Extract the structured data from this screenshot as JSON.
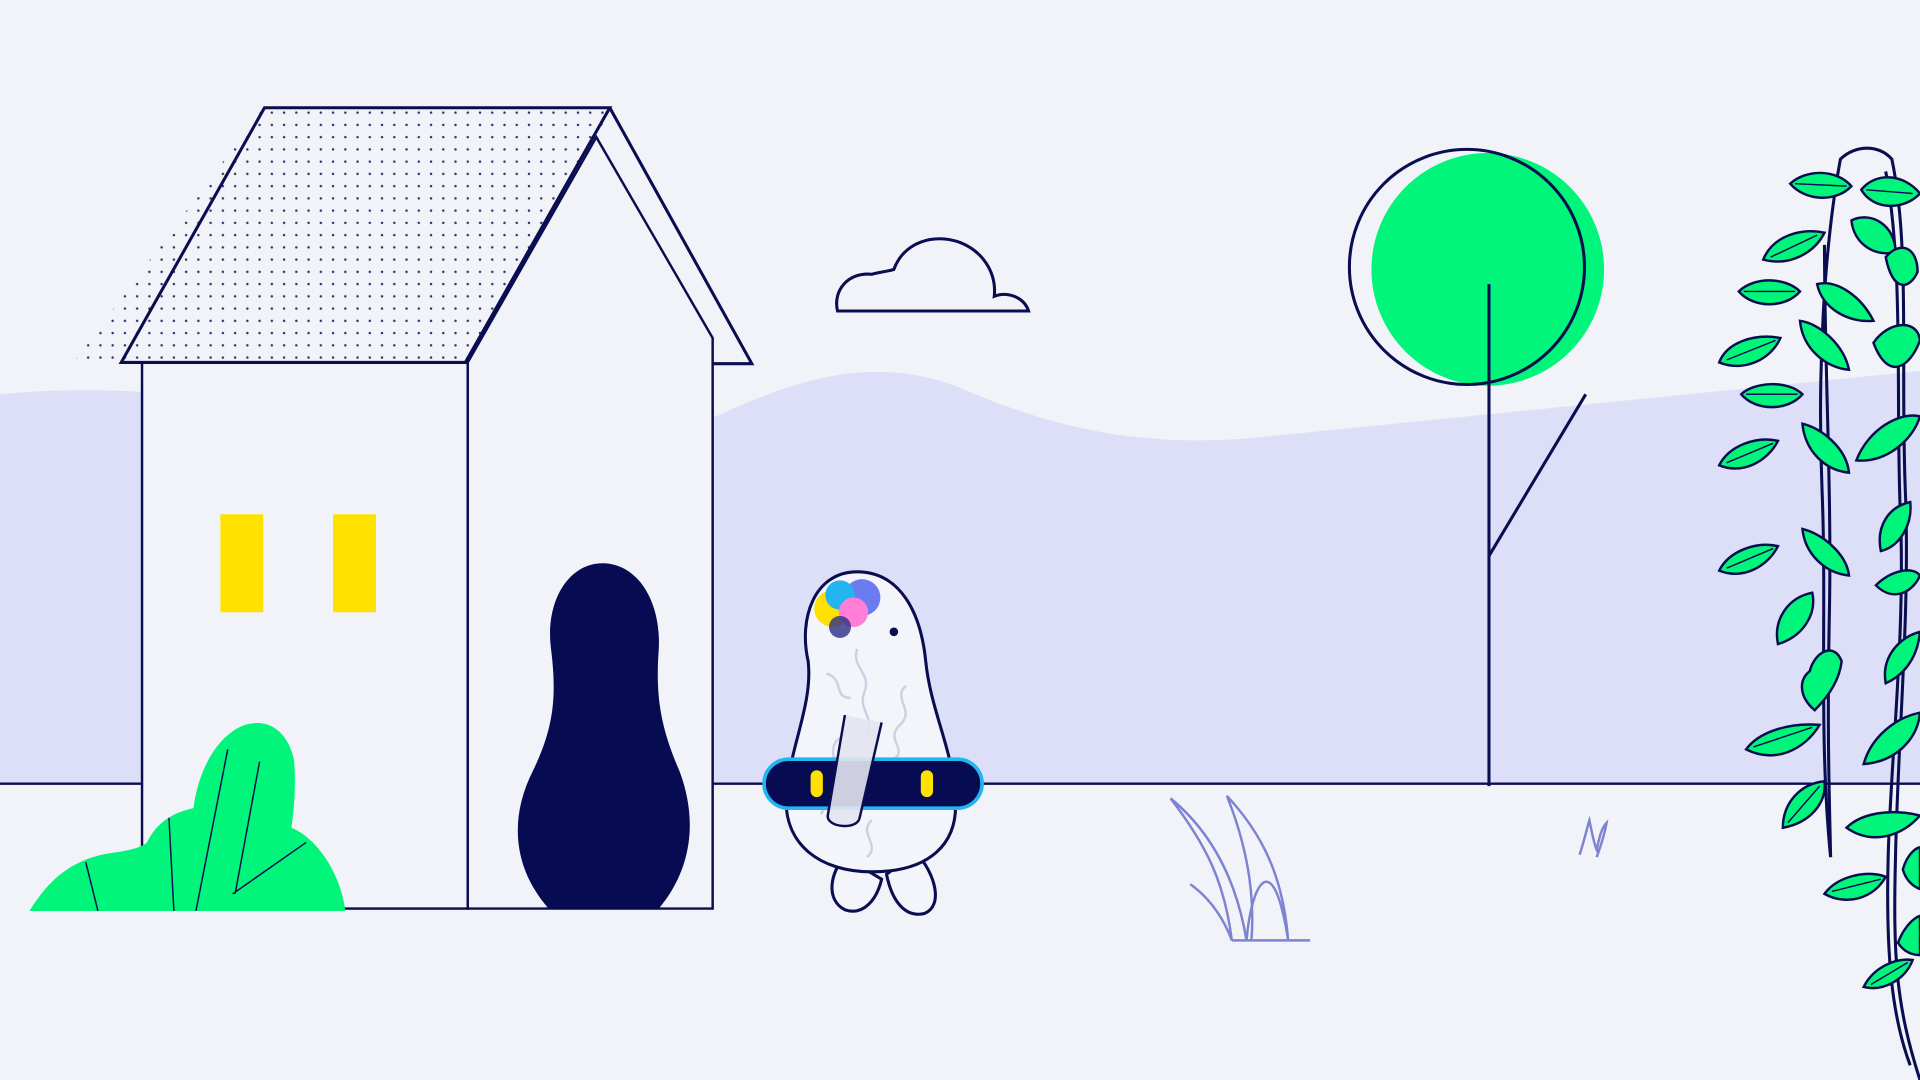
{
  "scene": {
    "subject": "illustration",
    "elements": [
      "house",
      "shrub",
      "character",
      "cloud",
      "tree",
      "vine",
      "grass"
    ]
  },
  "colors": {
    "background": "#f1f3f8",
    "hills": "#dcdff7",
    "outline": "#0a0d4f",
    "door": "#060b52",
    "window": "#ffe100",
    "leaf_green": "#00f57a",
    "ring_blue": "#22b5ef",
    "grass_outline": "#7d83d0"
  }
}
